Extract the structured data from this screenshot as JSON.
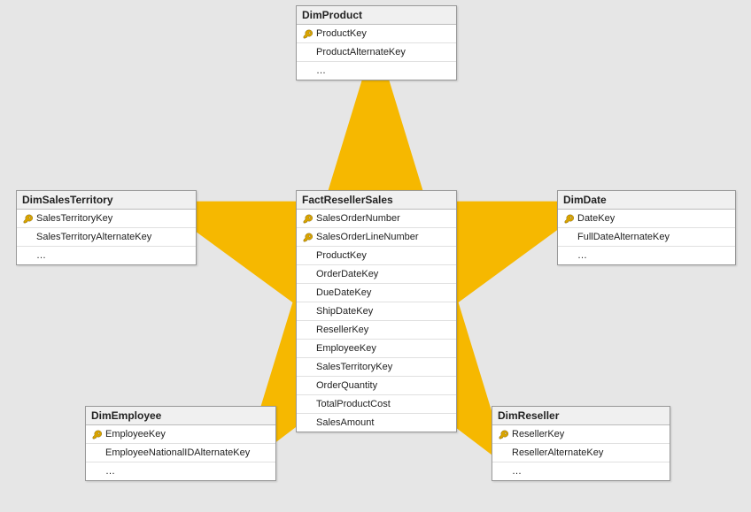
{
  "star_color": "#f6b800",
  "tables": {
    "dimproduct": {
      "title": "DimProduct",
      "rows": [
        {
          "key": true,
          "label": "ProductKey"
        },
        {
          "key": false,
          "label": "ProductAlternateKey"
        },
        {
          "key": false,
          "label": "…"
        }
      ]
    },
    "dimsalesterritory": {
      "title": "DimSalesTerritory",
      "rows": [
        {
          "key": true,
          "label": "SalesTerritoryKey"
        },
        {
          "key": false,
          "label": "SalesTerritoryAlternateKey"
        },
        {
          "key": false,
          "label": "…"
        }
      ]
    },
    "factresellersales": {
      "title": "FactResellerSales",
      "rows": [
        {
          "key": true,
          "label": "SalesOrderNumber"
        },
        {
          "key": true,
          "label": "SalesOrderLineNumber"
        },
        {
          "key": false,
          "label": "ProductKey"
        },
        {
          "key": false,
          "label": "OrderDateKey"
        },
        {
          "key": false,
          "label": "DueDateKey"
        },
        {
          "key": false,
          "label": "ShipDateKey"
        },
        {
          "key": false,
          "label": "ResellerKey"
        },
        {
          "key": false,
          "label": "EmployeeKey"
        },
        {
          "key": false,
          "label": "SalesTerritoryKey"
        },
        {
          "key": false,
          "label": "OrderQuantity"
        },
        {
          "key": false,
          "label": "TotalProductCost"
        },
        {
          "key": false,
          "label": "SalesAmount"
        }
      ]
    },
    "dimdate": {
      "title": "DimDate",
      "rows": [
        {
          "key": true,
          "label": "DateKey"
        },
        {
          "key": false,
          "label": "FullDateAlternateKey"
        },
        {
          "key": false,
          "label": "…"
        }
      ]
    },
    "dimemployee": {
      "title": "DimEmployee",
      "rows": [
        {
          "key": true,
          "label": "EmployeeKey"
        },
        {
          "key": false,
          "label": "EmployeeNationalIDAlternateKey"
        },
        {
          "key": false,
          "label": "…"
        }
      ]
    },
    "dimreseller": {
      "title": "DimReseller",
      "rows": [
        {
          "key": true,
          "label": "ResellerKey"
        },
        {
          "key": false,
          "label": "ResellerAlternateKey"
        },
        {
          "key": false,
          "label": "…"
        }
      ]
    }
  }
}
